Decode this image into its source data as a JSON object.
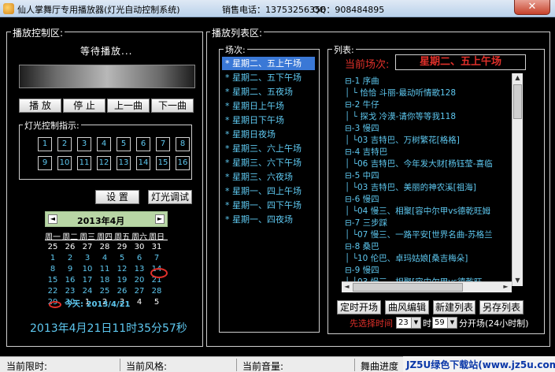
{
  "window": {
    "title": "仙人掌舞厅专用播放器(灯光自动控制系统)",
    "phone": "销售电话：13753256356",
    "qq": "QQ：908484895",
    "close_label": "✕"
  },
  "play_control": {
    "legend": "播放控制区:",
    "status": "等待播放...",
    "buttons": {
      "play": "播  放",
      "stop": "停  止",
      "prev": "上一曲",
      "next": "下一曲"
    },
    "light_legend": "灯光控制指示:",
    "lights_row1": [
      "1",
      "2",
      "3",
      "4",
      "5",
      "6",
      "7",
      "8"
    ],
    "lights_row2": [
      "9",
      "10",
      "11",
      "12",
      "13",
      "14",
      "15",
      "16"
    ],
    "settings": "设  置",
    "light_test": "灯光调试"
  },
  "calendar": {
    "prev_arrow": "◄",
    "next_arrow": "►",
    "month": "2013年4月",
    "weekdays": [
      "周一",
      "周二",
      "周三",
      "周四",
      "周五",
      "周六",
      "周日"
    ],
    "weeks": [
      [
        "25",
        "26",
        "27",
        "28",
        "29",
        "30",
        "31"
      ],
      [
        "1",
        "2",
        "3",
        "4",
        "5",
        "6",
        "7"
      ],
      [
        "8",
        "9",
        "10",
        "11",
        "12",
        "13",
        "14"
      ],
      [
        "15",
        "16",
        "17",
        "18",
        "19",
        "20",
        "21"
      ],
      [
        "22",
        "23",
        "24",
        "25",
        "26",
        "27",
        "28"
      ],
      [
        "29",
        "30",
        "1",
        "2",
        "3",
        "4",
        "5"
      ]
    ],
    "today_label": "今天: 2013/4/21"
  },
  "clock": "2013年4月21日11时35分57秒",
  "playlist_area": {
    "legend": "播放列表区:",
    "sessions_legend": "场次:",
    "sessions": [
      "星期二、五上午场",
      "星期二、五下午场",
      "星期二、五夜场",
      "星期日上午场",
      "星期日下午场",
      "星期日夜场",
      "星期三、六上午场",
      "星期三、六下午场",
      "星期三、六夜场",
      "星期一、四上午场",
      "星期一、四下午场",
      "星期一、四夜场"
    ],
    "list_legend": "列表:",
    "current_label": "当前场次:",
    "current_value": "星期二、五上午场",
    "tree": [
      {
        "num": "1",
        "name": "序曲"
      },
      {
        "num": "",
        "song": "恰恰   斗丽-最动听情歌128"
      },
      {
        "num": "2",
        "name": "牛仔"
      },
      {
        "num": "",
        "song": "探戈   冷漠-请你等等我118"
      },
      {
        "num": "3",
        "name": "慢四"
      },
      {
        "num": "03",
        "song": "吉特巴、万树繁花[格格]"
      },
      {
        "num": "4",
        "name": "吉特巴"
      },
      {
        "num": "06",
        "song": "吉特巴、今年发大财[杨钰莹-喜临"
      },
      {
        "num": "5",
        "name": "中四"
      },
      {
        "num": "03",
        "song": "吉特巴、美丽的神农溪[祖海]"
      },
      {
        "num": "6",
        "name": "慢四"
      },
      {
        "num": "04",
        "song": "慢三、相聚[容中尔甲vs德乾旺姆"
      },
      {
        "num": "7",
        "name": "三步踩"
      },
      {
        "num": "07",
        "song": "慢三、一路平安[世界名曲-苏格兰"
      },
      {
        "num": "8",
        "name": "桑巴"
      },
      {
        "num": "10",
        "song": "伦巴、卓玛姑娘[桑吉梅朵]"
      },
      {
        "num": "9",
        "name": "慢四"
      },
      {
        "num": "03",
        "song": "慢三、相聚[容中尔甲vs德乾旺"
      }
    ],
    "buttons": {
      "timed": "定时开场",
      "edit": "曲风编辑",
      "new": "新建列表",
      "save_as": "另存列表"
    },
    "schedule_label": "先选择时间",
    "hour": "23",
    "hour_unit": "时",
    "minute": "59",
    "minute_unit": "分开场(24小时制)"
  },
  "statusbar": {
    "time_limit": "当前限时:",
    "style": "当前风格:",
    "volume": "当前音量:",
    "progress": "舞曲进度",
    "watermark": "JZ5U绿色下载站(www.jz5u.com)"
  }
}
